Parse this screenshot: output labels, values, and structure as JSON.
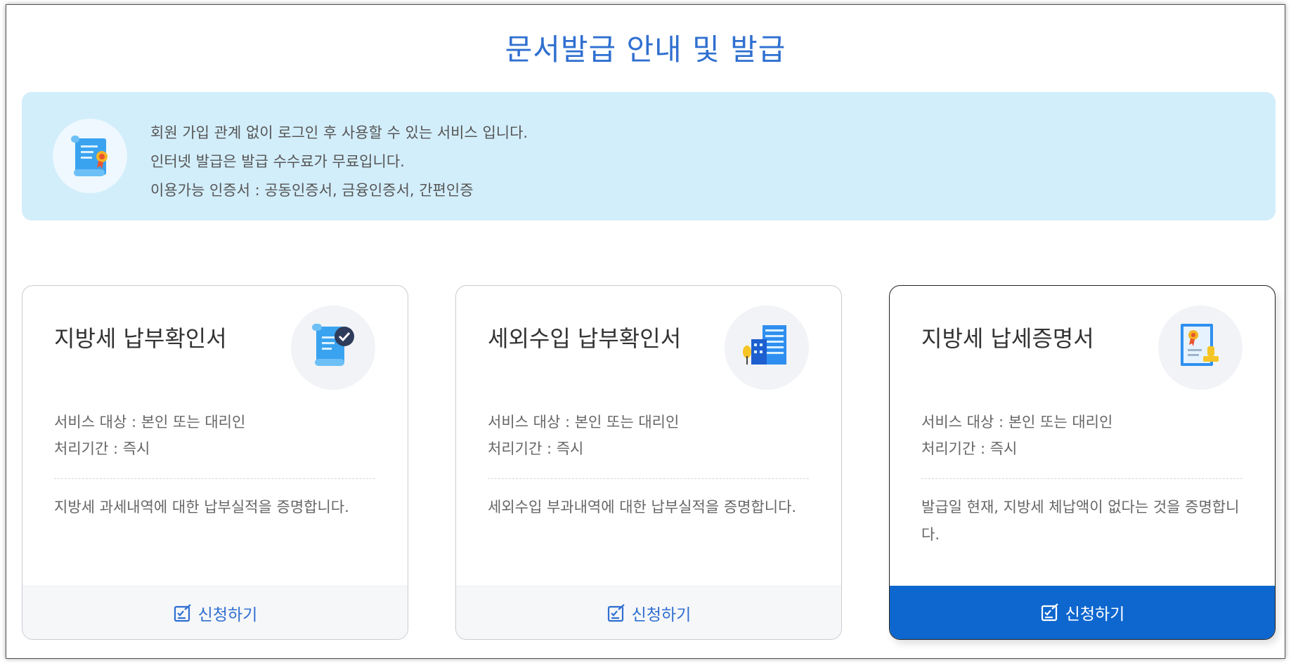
{
  "page": {
    "title": "문서발급 안내 및 발급"
  },
  "info": {
    "icon": "certificate-scroll-icon",
    "lines": [
      "회원 가입 관계 없이 로그인 후 사용할 수 있는 서비스 입니다.",
      "인터넷 발급은 발급 수수료가 무료입니다.",
      "이용가능 인증서 : 공동인증서, 금융인증서, 간편인증"
    ]
  },
  "cards": [
    {
      "title": "지방세 납부확인서",
      "icon": "document-check-icon",
      "target": "서비스 대상 : 본인 또는 대리인",
      "period": "처리기간 : 즉시",
      "description": "지방세 과세내역에 대한 납부실적을 증명합니다.",
      "button_label": "신청하기"
    },
    {
      "title": "세외수입 납부확인서",
      "icon": "building-icon",
      "target": "서비스 대상 : 본인 또는 대리인",
      "period": "처리기간 : 즉시",
      "description": "세외수입 부과내역에 대한 납부실적을 증명합니다.",
      "button_label": "신청하기"
    },
    {
      "title": "지방세 납세증명서",
      "icon": "certificate-stamp-icon",
      "target": "서비스 대상 : 본인 또는 대리인",
      "period": "처리기간 : 즉시",
      "description": "발급일 현재, 지방세 체납액이 없다는 것을 증명합니다.",
      "button_label": "신청하기"
    }
  ],
  "colors": {
    "accent": "#2f6fd0",
    "primary_button": "#0e67cf",
    "info_background": "#d3eefb"
  }
}
